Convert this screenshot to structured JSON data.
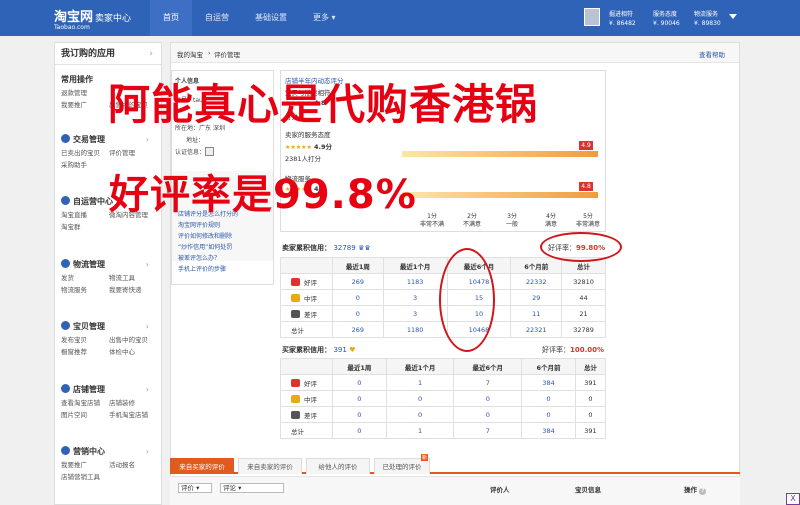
{
  "header": {
    "logo_cn": "淘宝网",
    "logo_sub": "卖家中心",
    "logo_en": "Taobao.com",
    "nav": [
      "首页",
      "自运营",
      "基础设置",
      "更多"
    ],
    "user_name": "掘进相符",
    "user_id": "¥. 86482",
    "stats": [
      {
        "label": "服务态度",
        "value": "¥. 90046"
      },
      {
        "label": "物流服务",
        "value": "¥. 89830"
      }
    ]
  },
  "sidebar": {
    "title": "我订购的应用",
    "sections": [
      {
        "title": "常用操作",
        "items": [
          "退款管理",
          "我要推广",
          "已卖出的宝贝",
          "出售中的宝贝"
        ]
      },
      {
        "title": "交易管理",
        "items": [
          "已卖出的宝贝",
          "评价管理",
          "采购助手"
        ]
      },
      {
        "title": "自运营中心",
        "items": [
          "淘宝直播",
          "微淘内容管理",
          "淘宝群"
        ]
      },
      {
        "title": "物流管理",
        "items": [
          "发货",
          "物流工具",
          "物流服务",
          "我要寄快递"
        ]
      },
      {
        "title": "宝贝管理",
        "items": [
          "发布宝贝",
          "出售中的宝贝",
          "橱窗推荐",
          "体检中心"
        ]
      },
      {
        "title": "店铺管理",
        "items": [
          "查看淘宝店铺",
          "店铺装修",
          "图片空间",
          "手机淘宝店铺"
        ]
      },
      {
        "title": "营销中心",
        "items": [
          "我要推广",
          "活动报名",
          "店铺营销工具"
        ]
      }
    ]
  },
  "breadcrumb": {
    "home": "我的淘宝",
    "current": "评价管理",
    "help": "查看帮助"
  },
  "info": {
    "title": "个人信息",
    "name_label": "账号",
    "name": "tauh",
    "area_label": "所在地",
    "area": "广东   深圳",
    "addr_label": "地址",
    "cert_label": "认证信息",
    "links": [
      "店铺评分是怎么打分的",
      "淘宝网评价规则",
      "评价如何修改和删除",
      "“炒作信用”如何处罚",
      "被差评怎么办？",
      "手机上评价的步骤"
    ]
  },
  "score": {
    "title": "店铺半年内动态评分",
    "rows": [
      {
        "label": "宝贝与描述相符",
        "score": "4.8",
        "count": "打分",
        "badge": ""
      },
      {
        "label": "卖家的服务态度",
        "score": "4.9分",
        "count": "2381人打分",
        "badge": "4.9"
      },
      {
        "label": "物流服务",
        "score": "4.8",
        "count": "打分",
        "badge": "4.8"
      }
    ],
    "scale": [
      {
        "n": "1分",
        "t": "非常不满"
      },
      {
        "n": "2分",
        "t": "不满意"
      },
      {
        "n": "3分",
        "t": "一般"
      },
      {
        "n": "4分",
        "t": "满意"
      },
      {
        "n": "5分",
        "t": "非常满意"
      }
    ]
  },
  "seller": {
    "title": "卖家累积信用：",
    "credit": "32789",
    "good_label": "好评率：",
    "good_rate": "99.80%",
    "headers": [
      "",
      "最近1周",
      "最近1个月",
      "最近6个月",
      "6个月前",
      "总计"
    ],
    "rows": [
      {
        "label": "好评",
        "values": [
          "269",
          "1183",
          "10478",
          "22332",
          "32810"
        ]
      },
      {
        "label": "中评",
        "values": [
          "0",
          "3",
          "15",
          "29",
          "44"
        ]
      },
      {
        "label": "差评",
        "values": [
          "0",
          "3",
          "10",
          "11",
          "21"
        ]
      },
      {
        "label": "总计",
        "values": [
          "269",
          "1180",
          "10468",
          "22321",
          "32789"
        ]
      }
    ]
  },
  "buyer": {
    "title": "买家累积信用：",
    "credit": "391",
    "good_label": "好评率：",
    "good_rate": "100.00%",
    "headers": [
      "",
      "最近1周",
      "最近1个月",
      "最近6个月",
      "6个月前",
      "总计"
    ],
    "rows": [
      {
        "label": "好评",
        "values": [
          "0",
          "1",
          "7",
          "384",
          "391"
        ]
      },
      {
        "label": "中评",
        "values": [
          "0",
          "0",
          "0",
          "0",
          "0"
        ]
      },
      {
        "label": "差评",
        "values": [
          "0",
          "0",
          "0",
          "0",
          "0"
        ]
      },
      {
        "label": "总计",
        "values": [
          "0",
          "1",
          "7",
          "384",
          "391"
        ]
      }
    ]
  },
  "tabs": {
    "items": [
      "来自买家的评价",
      "来自卖家的评价",
      "给他人的评价",
      "已处理的评价"
    ],
    "new_badge": "新"
  },
  "filter": {
    "sel1": "评价",
    "sel2": "评论",
    "col_reviewer": "评价人",
    "col_item": "宝贝信息",
    "col_op": "操作"
  },
  "overlay": {
    "line1": "阿能真心是代购香港锅",
    "line2": "好评率是99.8%"
  },
  "colors": {
    "brand": "#2f63b7",
    "accent": "#e25a1e",
    "overlay": "#e60012"
  }
}
